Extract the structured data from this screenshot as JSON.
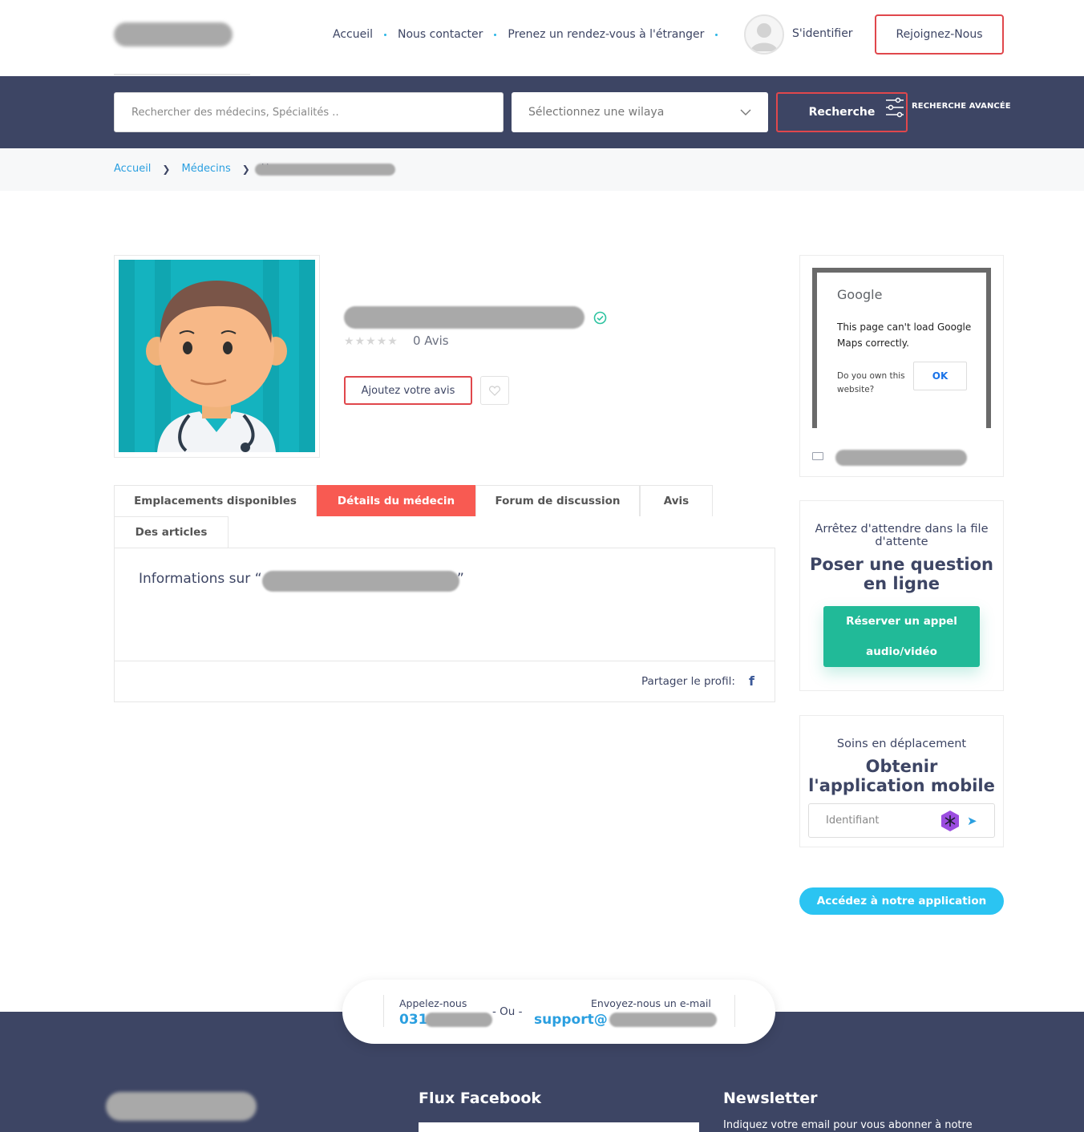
{
  "header": {
    "nav": [
      "Accueil",
      "Nous contacter",
      "Prenez un rendez-vous à l'étranger"
    ],
    "signin_label": "S'identifier",
    "join_label": "Rejoignez-Nous"
  },
  "search": {
    "placeholder": "Rechercher des médecins, Spécialités ..",
    "wilaya_label": "Sélectionnez une wilaya",
    "button_label": "Recherche",
    "advanced_label": "RECHERCHE AVANCÉE"
  },
  "breadcrumb": {
    "home": "Accueil",
    "doctors": "Médecins",
    "current": "H"
  },
  "profile": {
    "review_count": "0 Avis",
    "rating": 0,
    "add_review_label": "Ajoutez votre avis"
  },
  "tabs": [
    "Emplacements disponibles",
    "Détails du médecin",
    "Forum de discussion",
    "Avis",
    "Des articles"
  ],
  "details": {
    "info_prefix": "Informations sur “",
    "info_suffix": "”",
    "share_label": "Partager le profil:"
  },
  "map": {
    "google": "Google",
    "error_message": "This page can't load Google Maps correctly.",
    "own_question": "Do you own this website?",
    "ok_label": "OK"
  },
  "ask": {
    "subtitle": "Arrêtez d'attendre dans la file d'attente",
    "title": "Poser une question en ligne",
    "button_label": "Réserver un appel audio/vidéo"
  },
  "app": {
    "subtitle": "Soins en déplacement",
    "title": "Obtenir l'application mobile",
    "input_placeholder": "Identifiant",
    "access_label": "Accédez à notre application"
  },
  "contact": {
    "call_label": "Appelez-nous",
    "call_prefix": "031",
    "or_label": "- Ou -",
    "mail_label": "Envoyez-nous un e-mail",
    "mail_prefix": "support@"
  },
  "footer": {
    "facebook_title": "Flux Facebook",
    "newsletter_title": "Newsletter",
    "newsletter_text": "Indiquez votre email pour vous abonner à notre"
  },
  "colors": {
    "navy": "#3d4564",
    "accent_red": "#e0474c",
    "tab_active": "#f85a52",
    "green": "#21ba98",
    "cyan": "#2bc4f2",
    "link_blue": "#2a9fe0"
  }
}
